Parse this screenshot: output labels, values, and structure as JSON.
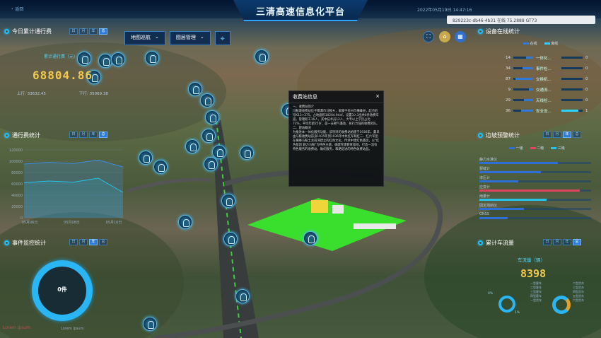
{
  "header": {
    "title": "三清高速信息化平台",
    "back_label": "返回",
    "session_text": "829223c-db46-4b31 在线 75.2888 GT73",
    "datetime": "2022年05月19日 14:47:16"
  },
  "today_traffic": {
    "title": "今日累计通行费",
    "tabs": [
      "日",
      "月",
      "年",
      "总"
    ],
    "sublabel": "累计通行费（元）",
    "amount": "68804.86",
    "inbound": "上行: 33632.45",
    "outbound": "下行: 35069.38"
  },
  "map_toolbar": {
    "nav": "地图巡航",
    "layers": "图层管理"
  },
  "device_stats": {
    "title": "设备在线统计",
    "legend": [
      "在线",
      "离线"
    ],
    "rows": [
      {
        "left": "14",
        "name": "一体化...",
        "right": "0",
        "pct": 0.35
      },
      {
        "left": "34",
        "name": "事件检...",
        "right": "0",
        "pct": 0.55
      },
      {
        "left": "87",
        "name": "交换机...",
        "right": "0",
        "pct": 0.9
      },
      {
        "left": "9",
        "name": "交通流...",
        "right": "0",
        "pct": 0.2
      },
      {
        "left": "29",
        "name": "天线检...",
        "right": "0",
        "pct": 0.45
      },
      {
        "left": "36",
        "name": "安全设...",
        "right": "1",
        "pct": 0.6
      }
    ]
  },
  "toll_stats": {
    "title": "通行费统计",
    "tabs": [
      "日",
      "月",
      "年",
      "总"
    ],
    "y_ticks": [
      "120000",
      "100000",
      "80000",
      "60000",
      "40000",
      "20000",
      "0"
    ],
    "x_ticks": [
      "05月06日",
      "05月08日",
      "05月10日"
    ]
  },
  "chart_data": {
    "type": "area",
    "x": [
      "05月06日",
      "05月07日",
      "05月08日",
      "05月09日",
      "05月10日"
    ],
    "series": [
      {
        "values": [
          95000,
          98000,
          96000,
          102000,
          90000
        ]
      },
      {
        "values": [
          62000,
          65000,
          63000,
          70000,
          45000
        ]
      }
    ],
    "ylim": [
      0,
      120000
    ]
  },
  "popup": {
    "title": "收费站信息",
    "body": "一、收费站简介\n马鞍塘收费站位于鹰潭市马鞍乡，隶属于抚州市横峰县，起点桩号K13+375，占地面积10204.94㎡，设置3入3出共6条收费车道，管辖职工16人，其中技术员12人，大专以上学历占比73%，平均年龄25岁，是一支朝气蓬勃、执行力强的收费团队。\n二、建站概况\n为推进本一体化服务功能，该项目的收费站始建于1936年，最早由马鞍收费站前身1935年到1936年中共红军和红二、红六军团在横峰马鞍土龙岗湾建立的红色文化，传承中建红色基因，以\"红色基因 魅力马鞍\"为特色主题，确建党建教育基地，打造一流有特色服务的收费站，做优服务，和路促进的特色收费站品。"
  },
  "lane_warn": {
    "title": "边坡预警统计",
    "tabs": [
      "日",
      "月",
      "年",
      "总"
    ],
    "legend": [
      "一级",
      "二级",
      "三级"
    ],
    "rows": [
      {
        "name": "静力水准仪",
        "pct": 0.7,
        "color": "#2d6fd6"
      },
      {
        "name": "裂缝计",
        "pct": 0.55,
        "color": "#2d6fd6"
      },
      {
        "name": "渗压计",
        "pct": 0.35,
        "color": "#2d6fd6"
      },
      {
        "name": "应变计",
        "pct": 0.9,
        "color": "#e0455f"
      },
      {
        "name": "雨量计",
        "pct": 0.6,
        "color": "#26c3ea"
      },
      {
        "name": "固定测斜仪",
        "pct": 0.4,
        "color": "#2d6fd6"
      },
      {
        "name": "GNSS",
        "pct": 0.25,
        "color": "#2d6fd6"
      }
    ]
  },
  "event_monitor": {
    "title": "事件监控统计",
    "tabs": [
      "日",
      "月",
      "年",
      "总"
    ],
    "count": "0件",
    "watermark": "Lorem ipsum",
    "watermark2": "Lorem ipsum"
  },
  "vehicle_flow": {
    "title": "累计车流量",
    "tabs": [
      "日",
      "月",
      "年",
      "总"
    ],
    "sublabel": "车流量（辆）",
    "count": "8398",
    "left_pct": "0%",
    "left_label": "1%",
    "legend": [
      "一型客车",
      "二型客车",
      "三型客车",
      "四型客车",
      "一型货车",
      "二型货车",
      "三型货车",
      "四型货车",
      "五型货车",
      "六型货车"
    ]
  }
}
